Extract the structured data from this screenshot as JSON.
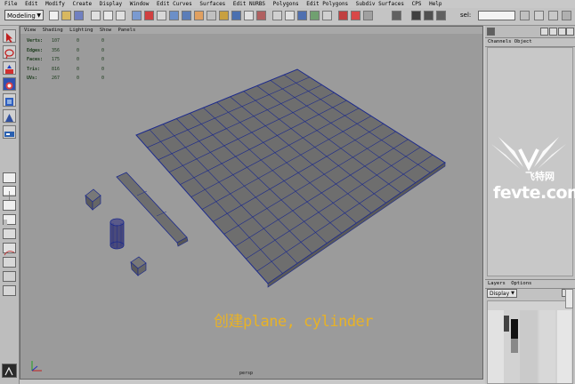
{
  "menubar": {
    "items": [
      "File",
      "Edit",
      "Modify",
      "Create",
      "Display",
      "Window",
      "Edit Curves",
      "Surfaces",
      "Edit NURBS",
      "Polygons",
      "Edit Polygons",
      "Subdiv Surfaces",
      "CPS",
      "Help"
    ]
  },
  "shelf": {
    "mode": "Modeling",
    "sel_label": "sel:"
  },
  "viewport": {
    "menu": [
      "View",
      "Shading",
      "Lighting",
      "Show",
      "Panels"
    ],
    "hud": [
      {
        "label": "Verts:",
        "v1": "107",
        "v2": "0",
        "v3": "0"
      },
      {
        "label": "Edges:",
        "v1": "356",
        "v2": "0",
        "v3": "0"
      },
      {
        "label": "Faces:",
        "v1": "175",
        "v2": "0",
        "v3": "0"
      },
      {
        "label": "Tris:",
        "v1": "816",
        "v2": "0",
        "v3": "0"
      },
      {
        "label": "UVs:",
        "v1": "267",
        "v2": "0",
        "v3": "0"
      }
    ],
    "camera": "persp",
    "caption": "创建plane, cylinder"
  },
  "channels": {
    "menu": "Channels Object"
  },
  "layers": {
    "menu": [
      "Layers",
      "Options"
    ],
    "display": "Display"
  },
  "watermark": {
    "cn": "飞特网",
    "en": "fevte.com"
  },
  "colors": {
    "wire": "#1c2a8c",
    "face": "#6e6e6e",
    "viewport_bg": "#9b9b9b",
    "caption": "#e8b226"
  }
}
